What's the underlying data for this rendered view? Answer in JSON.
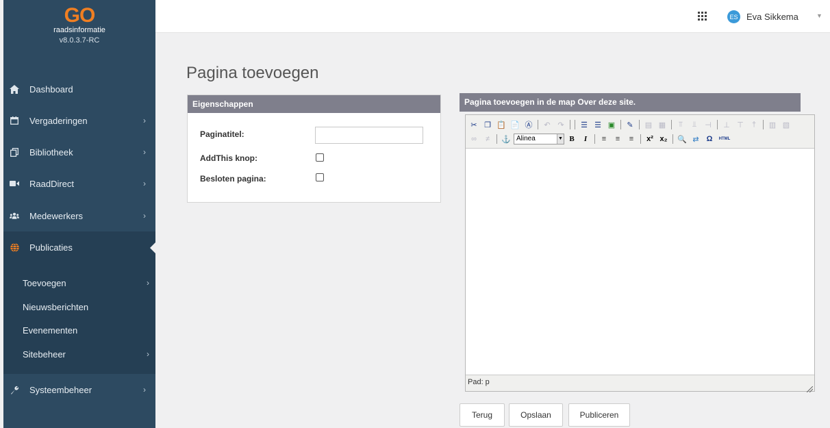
{
  "app": {
    "logo_text": "GO",
    "logo_subtitle": "raadsinformatie",
    "version": "v8.0.3.7-RC"
  },
  "sidebar": {
    "items": [
      {
        "label": "Dashboard",
        "icon": "home-icon"
      },
      {
        "label": "Vergaderingen",
        "icon": "calendar-icon"
      },
      {
        "label": "Bibliotheek",
        "icon": "copy-icon"
      },
      {
        "label": "RaadDirect",
        "icon": "video-icon"
      },
      {
        "label": "Medewerkers",
        "icon": "users-icon"
      },
      {
        "label": "Publicaties",
        "icon": "globe-icon"
      },
      {
        "label": "Systeembeheer",
        "icon": "wrench-icon"
      }
    ],
    "subitems": [
      {
        "label": "Toevoegen"
      },
      {
        "label": "Nieuwsberichten"
      },
      {
        "label": "Evenementen"
      },
      {
        "label": "Sitebeheer"
      }
    ]
  },
  "header": {
    "user_initials": "ES",
    "user_name": "Eva Sikkema"
  },
  "main": {
    "title": "Pagina toevoegen",
    "properties": {
      "heading": "Eigenschappen",
      "page_title_label": "Paginatitel:",
      "page_title_value": "",
      "addthis_label": "AddThis knop:",
      "addthis_checked": false,
      "private_label": "Besloten pagina:",
      "private_checked": false
    },
    "editor": {
      "heading": "Pagina toevoegen in de map Over deze site.",
      "format_value": "Alinea",
      "status_path": "Pad: p",
      "html_button": "HTML"
    },
    "buttons": {
      "back": "Terug",
      "save": "Opslaan",
      "publish": "Publiceren"
    }
  },
  "colors": {
    "sidebar_bg": "#2d4a61",
    "sidebar_active": "#253f54",
    "logo_accent": "#f07f22",
    "panel_header": "#7f7f8c",
    "avatar": "#3b9ad9"
  }
}
